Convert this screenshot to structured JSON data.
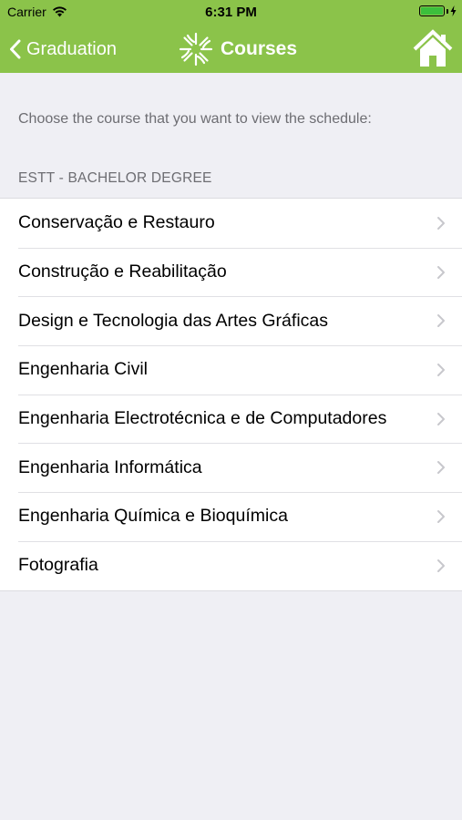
{
  "status_bar": {
    "carrier": "Carrier",
    "time": "6:31 PM",
    "battery_level": 1.0
  },
  "nav": {
    "back_label": "Graduation",
    "title": "Courses",
    "home_icon": "home-icon",
    "logo_icon": "asterisk-logo-icon"
  },
  "instruction": "Choose the course that you want to view the schedule:",
  "section": {
    "header": "ESTT - BACHELOR DEGREE"
  },
  "courses": [
    {
      "label": "Conservação e Restauro"
    },
    {
      "label": "Construção e Reabilitação"
    },
    {
      "label": "Design e Tecnologia das Artes Gráficas"
    },
    {
      "label": "Engenharia Civil"
    },
    {
      "label": "Engenharia Electrotécnica e de Computadores"
    },
    {
      "label": "Engenharia Informática"
    },
    {
      "label": "Engenharia Química e Bioquímica"
    },
    {
      "label": "Fotografia"
    }
  ],
  "colors": {
    "nav_background": "#8bc34a",
    "page_background": "#efeff4",
    "battery": "#3cbf3c"
  }
}
